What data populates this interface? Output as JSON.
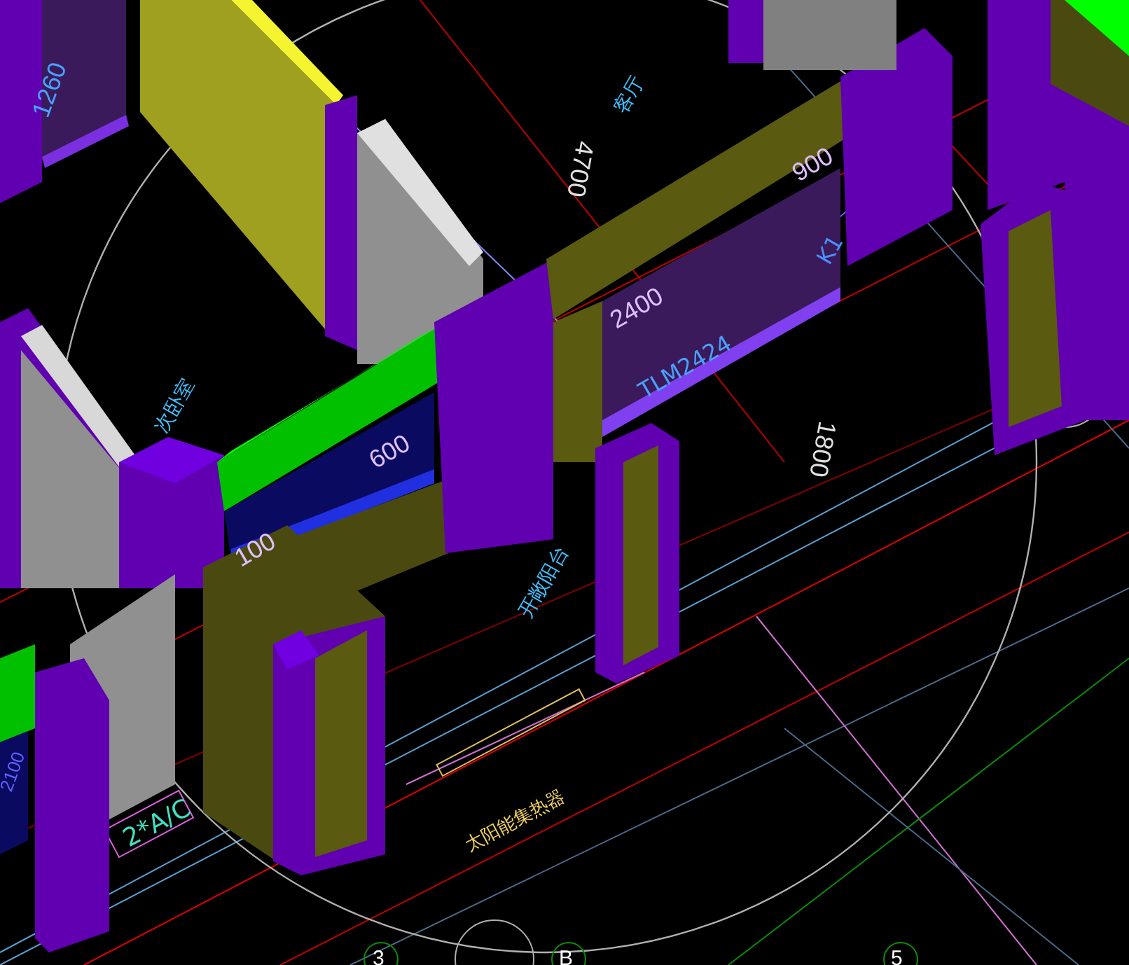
{
  "viewport": {
    "labels": [
      {
        "kind": "dimension",
        "text": "1260"
      },
      {
        "kind": "room",
        "text": "客厅"
      },
      {
        "kind": "dimension",
        "text": "4700"
      },
      {
        "kind": "dimension",
        "text": "900"
      },
      {
        "kind": "tag",
        "text": "K1"
      },
      {
        "kind": "dimension",
        "text": "2400"
      },
      {
        "kind": "tag",
        "text": "TLM2424"
      },
      {
        "kind": "dimension",
        "text": "1800"
      },
      {
        "kind": "room",
        "text": "次卧室"
      },
      {
        "kind": "dimension",
        "text": "600"
      },
      {
        "kind": "dimension",
        "text": "100"
      },
      {
        "kind": "room",
        "text": "开敞阳台"
      },
      {
        "kind": "dimension",
        "text": "2100"
      },
      {
        "kind": "tag",
        "text": "2*A/C"
      },
      {
        "kind": "equipment",
        "text": "太阳能集热器"
      },
      {
        "kind": "axis",
        "text": "3"
      },
      {
        "kind": "axis",
        "text": "B"
      },
      {
        "kind": "axis",
        "text": "5"
      }
    ]
  }
}
